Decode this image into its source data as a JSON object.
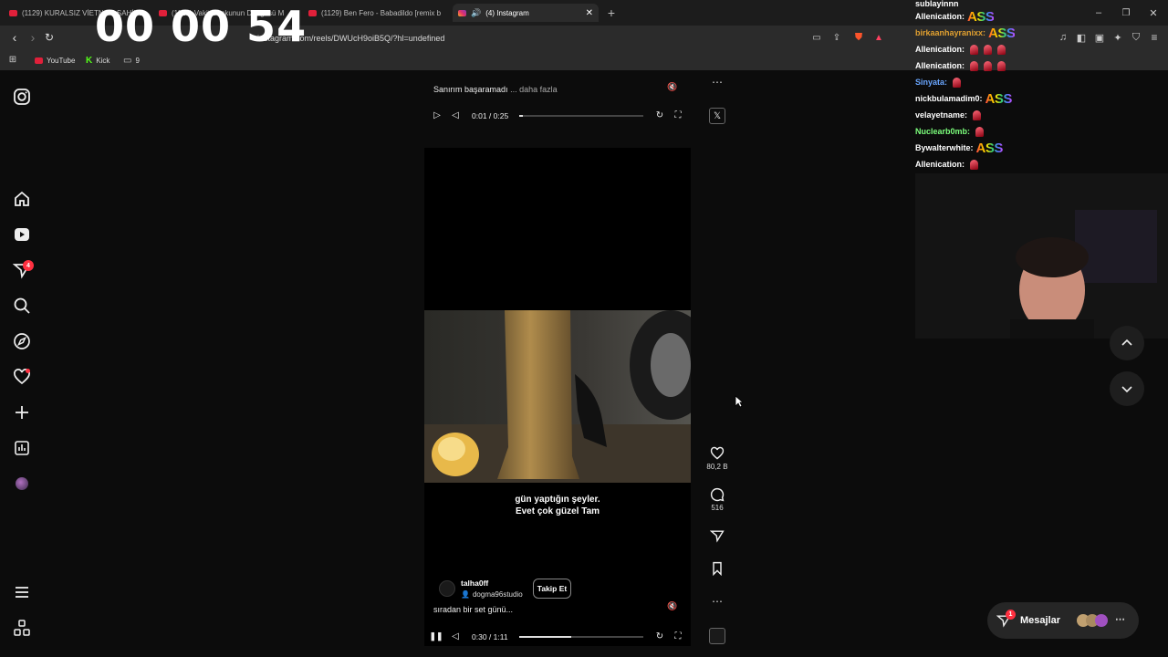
{
  "browser": {
    "tabs": [
      {
        "label": "(1129) KURALSIZ VİETNAM SAHİNE"
      },
      {
        "label": "(1129) Vakit Coşkunun Döngüsü M"
      },
      {
        "label": "(1129) Ben Fero - Babadildo [remix b"
      },
      {
        "label": "(4) Instagram"
      }
    ],
    "url": "instagram.com/reels/DWUcH9oiB5Q/?hl=undefined",
    "bookmarks": [
      {
        "label": "YouTube"
      },
      {
        "label": "Kick"
      },
      {
        "label": "9"
      }
    ]
  },
  "stream": {
    "timer": "00 00 54"
  },
  "sidebar": {
    "notifications_badge": "4"
  },
  "reel_top": {
    "caption": "Sanırım başaramadı",
    "more": "... daha fazla",
    "time": "0:01 / 0:25",
    "progress": 0.03
  },
  "reel_main": {
    "subtitle_line1": "gün yaptığın şeyler.",
    "subtitle_line2": "Evet çok güzel Tam",
    "username": "talha0ff",
    "collab": "dogma96studio",
    "follow_label": "Takip Et",
    "caption": "sıradan bir set günü...",
    "time": "0:30 / 1:11",
    "progress": 0.42,
    "likes": "80,2 B",
    "comments": "516"
  },
  "chat": {
    "messages": [
      {
        "user": "sublayinnn",
        "color": "#ffffff",
        "text": "",
        "ass": false,
        "emotes": 0
      },
      {
        "user": "Allenication:",
        "color": "#ffffff",
        "ass": true,
        "emotes": 0
      },
      {
        "user": "birkaanhayranixx:",
        "color": "#e0a030",
        "ass": true,
        "emotes": 0
      },
      {
        "user": "Allenication:",
        "color": "#ffffff",
        "ass": false,
        "emotes": 3
      },
      {
        "user": "Allenication:",
        "color": "#ffffff",
        "ass": false,
        "emotes": 3
      },
      {
        "user": "Sinyata:",
        "color": "#6aa6ff",
        "ass": false,
        "emotes": 1
      },
      {
        "user": "nickbulamadim0:",
        "color": "#ffffff",
        "ass": true,
        "emotes": 0
      },
      {
        "user": "velayetname:",
        "color": "#ffffff",
        "ass": false,
        "emotes": 1
      },
      {
        "user": "Nuclearb0mb:",
        "color": "#7cff7c",
        "ass": false,
        "emotes": 1
      },
      {
        "user": "Bywalterwhite:",
        "color": "#ffffff",
        "ass": true,
        "emotes": 0
      },
      {
        "user": "Allenication:",
        "color": "#ffffff",
        "ass": false,
        "emotes": 1
      }
    ],
    "ass_text": "ASS"
  },
  "messages_pill": {
    "label": "Mesajlar",
    "badge": "1"
  },
  "colors": {
    "accent_red": "#ff3040",
    "background": "#0c0c0c"
  }
}
